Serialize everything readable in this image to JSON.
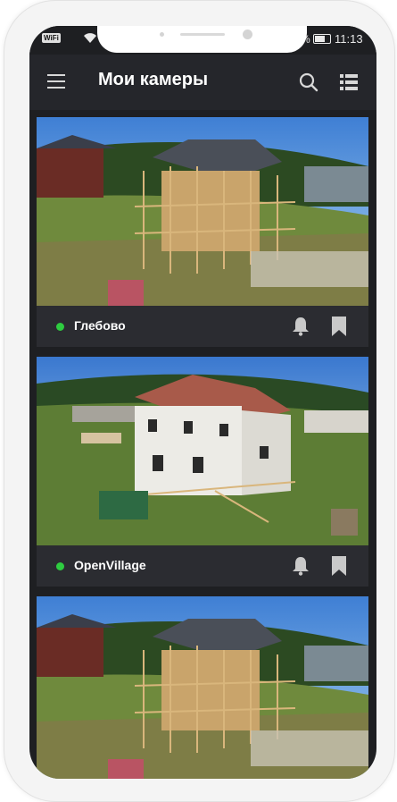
{
  "statusbar": {
    "wifi_badge": "WiFi",
    "battery_percent": "%",
    "time": "11:13"
  },
  "appbar": {
    "title": "Мои камеры",
    "menu_icon": "hamburger-menu-icon",
    "search_icon": "search-icon",
    "list_icon": "list-view-icon"
  },
  "cameras": [
    {
      "name": "Глебово",
      "status": "online",
      "status_color": "#2ecc40"
    },
    {
      "name": "OpenVillage",
      "status": "online",
      "status_color": "#2ecc40"
    },
    {
      "name": "",
      "status": "online",
      "status_color": "#2ecc40"
    }
  ],
  "colors": {
    "background": "#1e1f22",
    "appbar": "#25262b",
    "card_footer": "#2b2c31",
    "icon": "#c9c9c9"
  }
}
